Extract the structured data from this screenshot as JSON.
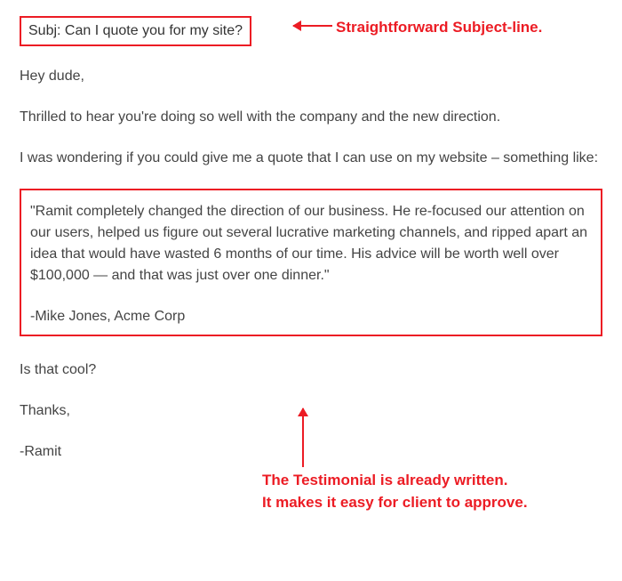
{
  "subject": "Subj: Can I quote you for my site?",
  "greeting": "Hey dude,",
  "para1": "Thrilled to hear you're doing so well with the company and the new direction.",
  "para2": "I was wondering if you could give me a quote that I can use on my website – something like:",
  "testimonial": {
    "quote": "\"Ramit completely changed the direction of our business. He re-focused our attention on our users, helped us figure out several lucrative marketing channels, and ripped apart an idea that would have wasted 6 months of our time. His advice will be worth well over $100,000 — and that was just over one dinner.\"",
    "attribution": "-Mike Jones, Acme Corp"
  },
  "para3": "Is that cool?",
  "closing": "Thanks,",
  "signature": "-Ramit",
  "annotations": {
    "a1": "Straightforward Subject-line.",
    "a2_line1": "The Testimonial is already written.",
    "a2_line2": "It makes it easy for client to approve."
  },
  "colors": {
    "highlight": "#ec1c24",
    "text": "#444444"
  }
}
